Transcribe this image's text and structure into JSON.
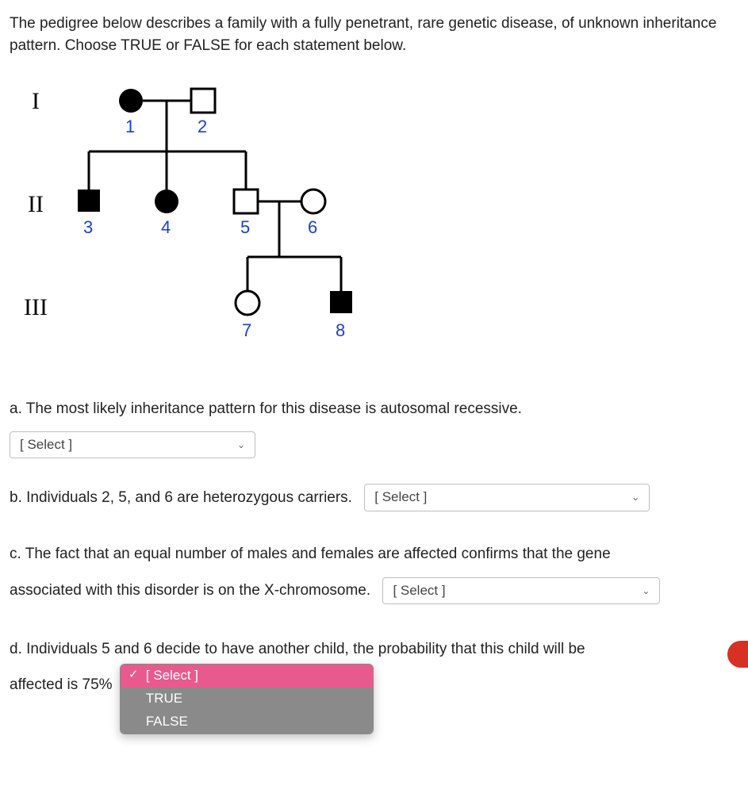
{
  "intro": "The pedigree below describes a family with a fully penetrant, rare genetic disease, of unknown inheritance pattern. Choose TRUE or FALSE for each statement below.",
  "generations": {
    "g1": "I",
    "g2": "II",
    "g3": "III"
  },
  "individuals": {
    "p1": "1",
    "p2": "2",
    "p3": "3",
    "p4": "4",
    "p5": "5",
    "p6": "6",
    "p7": "7",
    "p8": "8"
  },
  "qa": {
    "text": "a. The most likely inheritance pattern for this disease is autosomal recessive.",
    "select": "[ Select ]"
  },
  "qb": {
    "text": "b. Individuals 2, 5, and 6 are heterozygous carriers.",
    "select": "[ Select ]"
  },
  "qc": {
    "text_before": "c. The fact that an equal number of males and females are affected confirms that the gene",
    "text_after": "associated with this disorder is on the X-chromosome.",
    "select": "[ Select ]"
  },
  "qd": {
    "text_before": "d. Individuals 5 and 6 decide to have another child, the probability that this child will be",
    "text_after": "affected is 75%",
    "options": {
      "placeholder": "[ Select ]",
      "true": "TRUE",
      "false": "FALSE"
    }
  }
}
